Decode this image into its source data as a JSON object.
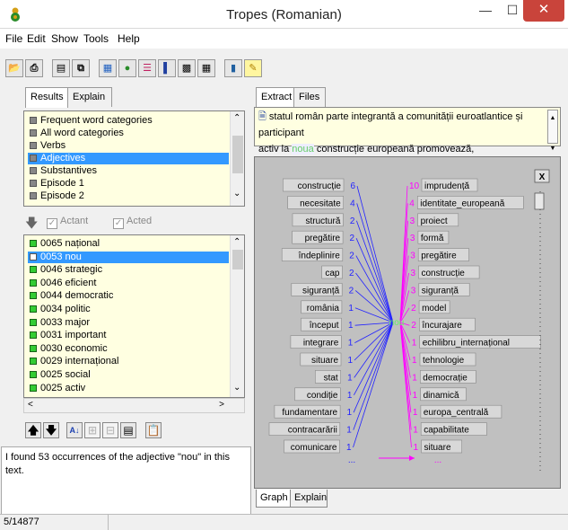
{
  "window": {
    "title": "Tropes (Romanian)"
  },
  "menu": [
    "File",
    "Edit",
    "Show",
    "Tools",
    "Help"
  ],
  "left_tabs": [
    "Results",
    "Explain"
  ],
  "categories": [
    {
      "label": "Frequent word categories",
      "selected": false
    },
    {
      "label": "All word categories",
      "selected": false
    },
    {
      "label": "Verbs",
      "selected": false
    },
    {
      "label": "Adjectives",
      "selected": true
    },
    {
      "label": "Substantives",
      "selected": false
    },
    {
      "label": "Episode 1",
      "selected": false
    },
    {
      "label": "Episode 2",
      "selected": false
    }
  ],
  "actant_bar": {
    "actant": "Actant",
    "acted": "Acted"
  },
  "words": [
    {
      "label": "0065 național",
      "selected": false
    },
    {
      "label": "0053 nou",
      "selected": true
    },
    {
      "label": "0046 strategic",
      "selected": false
    },
    {
      "label": "0046 eficient",
      "selected": false
    },
    {
      "label": "0044 democratic",
      "selected": false
    },
    {
      "label": "0034 politic",
      "selected": false
    },
    {
      "label": "0033 major",
      "selected": false
    },
    {
      "label": "0031 important",
      "selected": false
    },
    {
      "label": "0030 economic",
      "selected": false
    },
    {
      "label": "0029 internațional",
      "selected": false
    },
    {
      "label": "0025 social",
      "selected": false
    },
    {
      "label": "0025 activ",
      "selected": false
    }
  ],
  "result_text": "I found 53 occurrences of the adjective \"nou\" in this text.",
  "right_tabs": [
    "Extract",
    "Files"
  ],
  "extract": {
    "line1": "statul român parte integrantă a comunității euroatlantice și participant",
    "line2_prefix": "activ la ",
    "highlight": "noua",
    "line2_suffix": " construcție europeană promovează,"
  },
  "graph": {
    "center": "nou",
    "left_color": "#2222ff",
    "right_color": "#ff00ff",
    "left": [
      {
        "word": "construcție",
        "count": "6"
      },
      {
        "word": "necesitate",
        "count": "4"
      },
      {
        "word": "structură",
        "count": "2"
      },
      {
        "word": "pregătire",
        "count": "2"
      },
      {
        "word": "îndeplinire",
        "count": "2"
      },
      {
        "word": "cap",
        "count": "2"
      },
      {
        "word": "siguranță",
        "count": "2"
      },
      {
        "word": "românia",
        "count": "1"
      },
      {
        "word": "început",
        "count": "1"
      },
      {
        "word": "integrare",
        "count": "1"
      },
      {
        "word": "situare",
        "count": "1"
      },
      {
        "word": "stat",
        "count": "1"
      },
      {
        "word": "condiție",
        "count": "1"
      },
      {
        "word": "fundamentare",
        "count": "1"
      },
      {
        "word": "contracarării",
        "count": "1"
      },
      {
        "word": "comunicare",
        "count": "1"
      }
    ],
    "right": [
      {
        "word": "imprudență",
        "count": "10"
      },
      {
        "word": "identitate_europeană",
        "count": "4"
      },
      {
        "word": "proiect",
        "count": "3"
      },
      {
        "word": "formă",
        "count": "3"
      },
      {
        "word": "pregătire",
        "count": "3"
      },
      {
        "word": "construcție",
        "count": "3"
      },
      {
        "word": "siguranță",
        "count": "3"
      },
      {
        "word": "model",
        "count": "2"
      },
      {
        "word": "încurajare",
        "count": "2"
      },
      {
        "word": "echilibru_internațional",
        "count": "1"
      },
      {
        "word": "tehnologie",
        "count": "1"
      },
      {
        "word": "democrație",
        "count": "1"
      },
      {
        "word": "dinamică",
        "count": "1"
      },
      {
        "word": "europa_centrală",
        "count": "1"
      },
      {
        "word": "capabilitate",
        "count": "1"
      },
      {
        "word": "situare",
        "count": "1"
      }
    ],
    "ellipsis": "...",
    "close_label": "X"
  },
  "graph_tabs": [
    "Graph",
    "Explain"
  ],
  "status": "5/14877"
}
